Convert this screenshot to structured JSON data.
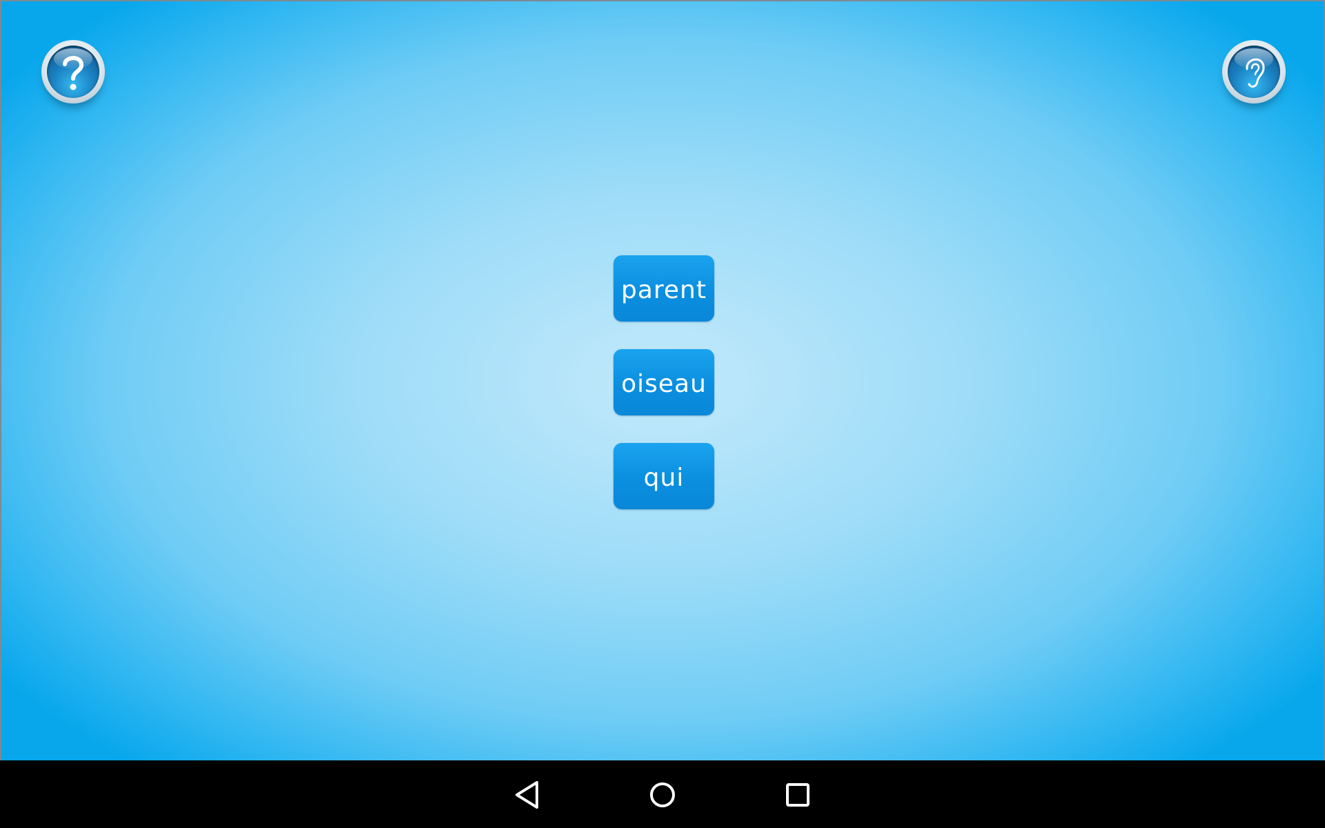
{
  "header": {
    "help_icon": "question-mark-icon",
    "listen_icon": "ear-icon"
  },
  "words": {
    "items": [
      {
        "label": "parent"
      },
      {
        "label": "oiseau"
      },
      {
        "label": "qui"
      }
    ]
  },
  "colors": {
    "background_center": "#c2e9fb",
    "background_edge": "#08a7ec",
    "word_button": "#0b8fe0",
    "word_text": "#ffffff",
    "nav_bar": "#000000"
  },
  "navigation": {
    "back_icon": "back-triangle-icon",
    "home_icon": "home-circle-icon",
    "recents_icon": "recents-square-icon"
  }
}
